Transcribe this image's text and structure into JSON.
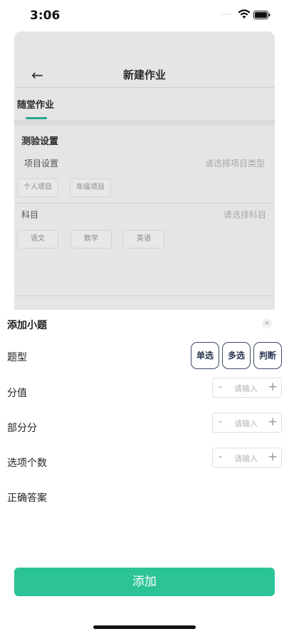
{
  "status": {
    "time": "3:06"
  },
  "background": {
    "title": "新建作业",
    "tab": "随堂作业",
    "section_title": "测验设置",
    "project_label": "项目设置",
    "project_placeholder": "请选择项目类型",
    "project_options": [
      "个人项目",
      "年级项目"
    ],
    "subject_label": "科目",
    "subject_placeholder": "请选择科目",
    "subject_options": [
      "语文",
      "数学",
      "英语"
    ]
  },
  "panel": {
    "title": "添加小题",
    "close_symbol": "×",
    "question_type_label": "题型",
    "question_types": [
      "单选",
      "多选",
      "判断"
    ],
    "score_label": "分值",
    "partial_label": "部分分",
    "options_count_label": "选项个数",
    "answer_label": "正确答案",
    "stepper": {
      "minus": "-",
      "plus": "+",
      "placeholder": "请输入"
    },
    "add_label": "添加"
  },
  "colors": {
    "accent": "#2cc397",
    "tab_underline": "#28a88d",
    "type_border": "#3b4a66"
  }
}
